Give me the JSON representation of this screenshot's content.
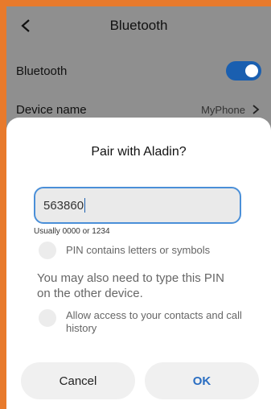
{
  "header": {
    "title": "Bluetooth",
    "back_icon": "chevron-left-icon"
  },
  "settings": {
    "bluetooth_label": "Bluetooth",
    "bluetooth_enabled": true,
    "device_name_label": "Device name",
    "device_name_value": "MyPhone"
  },
  "dialog": {
    "title": "Pair with Aladin?",
    "pin_value": "563860",
    "pin_hint": "Usually 0000 or 1234",
    "option_letters": "PIN contains letters or symbols",
    "note": "You may also need to type this PIN on the other device.",
    "option_contacts": "Allow access to your contacts and call history",
    "cancel_label": "Cancel",
    "ok_label": "OK"
  },
  "colors": {
    "accent": "#1a5fb0",
    "ok_text": "#2a6ec2",
    "frame_border": "#e87a2c"
  }
}
